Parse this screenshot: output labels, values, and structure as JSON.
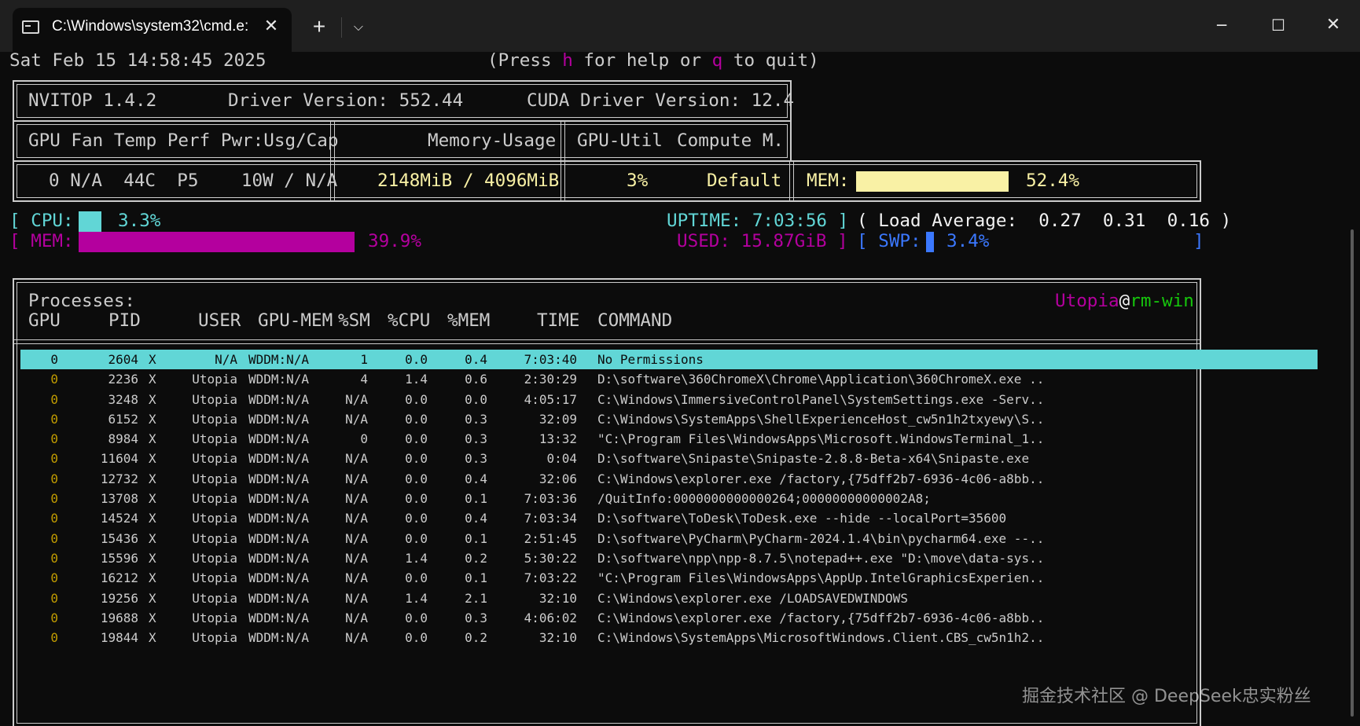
{
  "window": {
    "tab_title": "C:\\Windows\\system32\\cmd.e:",
    "close_tab": "✕",
    "new_tab": "+",
    "dropdown": "⌵",
    "minimize": "─",
    "maximize": "☐",
    "close": "✕"
  },
  "header": {
    "datetime": "Sat Feb 15 14:58:45 2025",
    "help_prefix": "(Press ",
    "help_key": "h",
    "help_mid": " for help or ",
    "quit_key": "q",
    "help_suffix": " to quit)"
  },
  "info": {
    "version": "NVITOP 1.4.2",
    "driver": "Driver Version: 552.44",
    "cuda": "CUDA Driver Version: 12.4"
  },
  "gpu_table": {
    "head_left": "GPU Fan Temp Perf Pwr:Usg/Cap",
    "head_mid": "Memory-Usage",
    "head_util": "GPU-Util",
    "head_compute": "Compute M.",
    "row_left": "0 N/A  44C  P5    10W / N/A",
    "row_mid": "2148MiB / 4096MiB",
    "row_util": "3%",
    "row_compute": "Default",
    "mem_label": "MEM:",
    "mem_percent": "52.4%",
    "mem_fraction": 0.524
  },
  "host": {
    "cpu_open": "[",
    "cpu_label": "CPU:",
    "cpu_percent": "3.3%",
    "cpu_fraction": 0.033,
    "uptime": "UPTIME: 7:03:56",
    "uptime_close": "]",
    "load_open": "(",
    "load_label": "Load Average:",
    "load1": "0.27",
    "load5": "0.31",
    "load15": "0.16",
    "load_close": ")",
    "mem_open": "[",
    "mem_label": "MEM:",
    "mem_percent": "39.9%",
    "mem_fraction": 0.399,
    "used": "USED: 15.87GiB",
    "used_close": "]",
    "swp_open": "[",
    "swp_label": "SWP:",
    "swp_percent": "3.4%",
    "swp_fraction": 0.034,
    "swp_close": "]"
  },
  "processes": {
    "title": "Processes:",
    "user": "Utopia",
    "at": "@",
    "host": "rm-win",
    "columns": [
      "GPU",
      "PID",
      "USER",
      "GPU-MEM",
      "%SM",
      "%CPU",
      "%MEM",
      "TIME",
      "COMMAND"
    ],
    "rows": [
      {
        "gpu": "0",
        "pid": "2604",
        "type": "X",
        "user": "N/A",
        "gpumem": "WDDM:N/A",
        "sm": "1",
        "cpu": "0.0",
        "mem": "0.4",
        "time": "7:03:40",
        "cmd": "No Permissions"
      },
      {
        "gpu": "0",
        "pid": "2236",
        "type": "X",
        "user": "Utopia",
        "gpumem": "WDDM:N/A",
        "sm": "4",
        "cpu": "1.4",
        "mem": "0.6",
        "time": "2:30:29",
        "cmd": "D:\\software\\360ChromeX\\Chrome\\Application\\360ChromeX.exe .."
      },
      {
        "gpu": "0",
        "pid": "3248",
        "type": "X",
        "user": "Utopia",
        "gpumem": "WDDM:N/A",
        "sm": "N/A",
        "cpu": "0.0",
        "mem": "0.0",
        "time": "4:05:17",
        "cmd": "C:\\Windows\\ImmersiveControlPanel\\SystemSettings.exe -Serv.."
      },
      {
        "gpu": "0",
        "pid": "6152",
        "type": "X",
        "user": "Utopia",
        "gpumem": "WDDM:N/A",
        "sm": "N/A",
        "cpu": "0.0",
        "mem": "0.3",
        "time": "32:09",
        "cmd": "C:\\Windows\\SystemApps\\ShellExperienceHost_cw5n1h2txyewy\\S.."
      },
      {
        "gpu": "0",
        "pid": "8984",
        "type": "X",
        "user": "Utopia",
        "gpumem": "WDDM:N/A",
        "sm": "0",
        "cpu": "0.0",
        "mem": "0.3",
        "time": "13:32",
        "cmd": "\"C:\\Program Files\\WindowsApps\\Microsoft.WindowsTerminal_1.."
      },
      {
        "gpu": "0",
        "pid": "11604",
        "type": "X",
        "user": "Utopia",
        "gpumem": "WDDM:N/A",
        "sm": "N/A",
        "cpu": "0.0",
        "mem": "0.3",
        "time": "0:04",
        "cmd": "D:\\software\\Snipaste\\Snipaste-2.8.8-Beta-x64\\Snipaste.exe"
      },
      {
        "gpu": "0",
        "pid": "12732",
        "type": "X",
        "user": "Utopia",
        "gpumem": "WDDM:N/A",
        "sm": "N/A",
        "cpu": "0.0",
        "mem": "0.4",
        "time": "32:06",
        "cmd": "C:\\Windows\\explorer.exe /factory,{75dff2b7-6936-4c06-a8bb.."
      },
      {
        "gpu": "0",
        "pid": "13708",
        "type": "X",
        "user": "Utopia",
        "gpumem": "WDDM:N/A",
        "sm": "N/A",
        "cpu": "0.0",
        "mem": "0.1",
        "time": "7:03:36",
        "cmd": "/QuitInfo:0000000000000264;00000000000002A8;"
      },
      {
        "gpu": "0",
        "pid": "14524",
        "type": "X",
        "user": "Utopia",
        "gpumem": "WDDM:N/A",
        "sm": "N/A",
        "cpu": "0.0",
        "mem": "0.4",
        "time": "7:03:34",
        "cmd": "D:\\software\\ToDesk\\ToDesk.exe --hide --localPort=35600"
      },
      {
        "gpu": "0",
        "pid": "15436",
        "type": "X",
        "user": "Utopia",
        "gpumem": "WDDM:N/A",
        "sm": "N/A",
        "cpu": "0.0",
        "mem": "0.1",
        "time": "2:51:45",
        "cmd": "D:\\software\\PyCharm\\PyCharm-2024.1.4\\bin\\pycharm64.exe --.."
      },
      {
        "gpu": "0",
        "pid": "15596",
        "type": "X",
        "user": "Utopia",
        "gpumem": "WDDM:N/A",
        "sm": "N/A",
        "cpu": "1.4",
        "mem": "0.2",
        "time": "5:30:22",
        "cmd": "D:\\software\\npp\\npp-8.7.5\\notepad++.exe \"D:\\move\\data-sys.."
      },
      {
        "gpu": "0",
        "pid": "16212",
        "type": "X",
        "user": "Utopia",
        "gpumem": "WDDM:N/A",
        "sm": "N/A",
        "cpu": "0.0",
        "mem": "0.1",
        "time": "7:03:22",
        "cmd": "\"C:\\Program Files\\WindowsApps\\AppUp.IntelGraphicsExperien.."
      },
      {
        "gpu": "0",
        "pid": "19256",
        "type": "X",
        "user": "Utopia",
        "gpumem": "WDDM:N/A",
        "sm": "N/A",
        "cpu": "1.4",
        "mem": "2.1",
        "time": "32:10",
        "cmd": "C:\\Windows\\explorer.exe /LOADSAVEDWINDOWS"
      },
      {
        "gpu": "0",
        "pid": "19688",
        "type": "X",
        "user": "Utopia",
        "gpumem": "WDDM:N/A",
        "sm": "N/A",
        "cpu": "0.0",
        "mem": "0.3",
        "time": "4:06:02",
        "cmd": "C:\\Windows\\explorer.exe /factory,{75dff2b7-6936-4c06-a8bb.."
      },
      {
        "gpu": "0",
        "pid": "19844",
        "type": "X",
        "user": "Utopia",
        "gpumem": "WDDM:N/A",
        "sm": "N/A",
        "cpu": "0.0",
        "mem": "0.2",
        "time": "32:10",
        "cmd": "C:\\Windows\\SystemApps\\MicrosoftWindows.Client.CBS_cw5n1h2.."
      }
    ]
  },
  "watermark": "掘金技术社区 @ DeepSeek忠实粉丝"
}
